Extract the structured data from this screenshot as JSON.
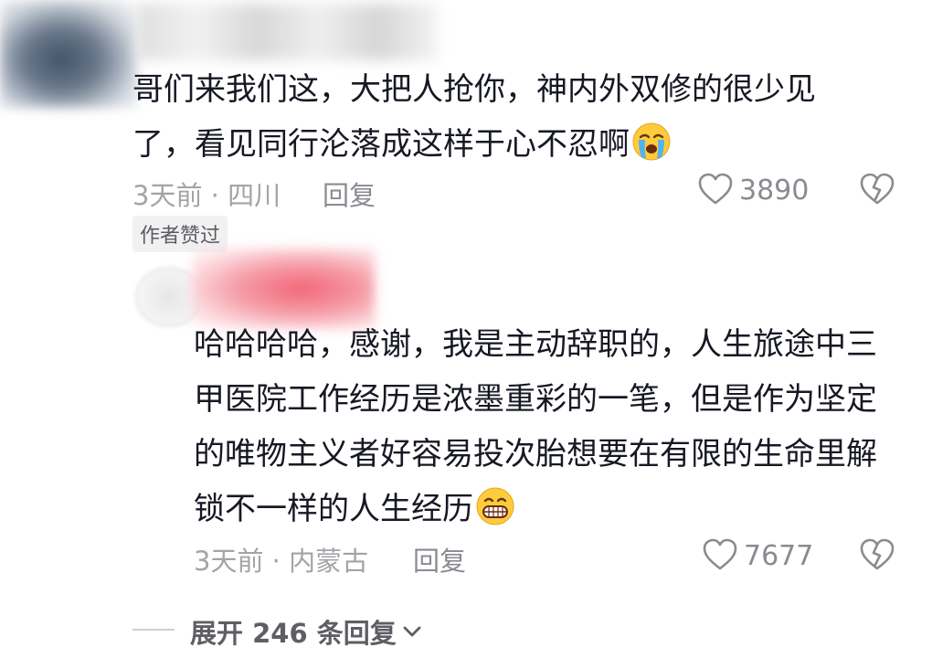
{
  "comments": [
    {
      "text_line1": "哥们来我们这，大把人抢你，神内外双修的很少见",
      "text_line2": "了，看见同行沦落成这样于心不忍啊",
      "emoji": "loudly-crying-face",
      "time_location": "3天前 · 四川",
      "reply_label": "回复",
      "like_count": "3890",
      "author_badge": "作者赞过"
    },
    {
      "text_line1": "哈哈哈哈，感谢，我是主动辞职的，人生旅途中三",
      "text_line2": "甲医院工作经历是浓墨重彩的一笔，但是作为坚定",
      "text_line3": "的唯物主义者好容易投次胎想要在有限的生命里解",
      "text_line4": "锁不一样的人生经历",
      "emoji": "grinning-face",
      "time_location": "3天前 · 内蒙古",
      "reply_label": "回复",
      "like_count": "7677"
    }
  ],
  "expand_replies": "展开 246 条回复",
  "colors": {
    "text": "#161823",
    "meta": "#a3a4a8",
    "secondary": "#8a8b91",
    "badge_bg": "#f1f1f2"
  }
}
